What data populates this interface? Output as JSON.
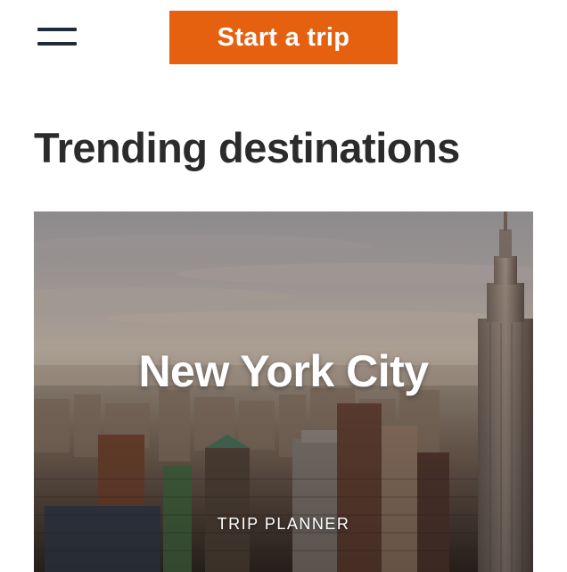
{
  "header": {
    "menu_icon": "hamburger-menu-icon",
    "cta_label": "Start a trip",
    "cta_color": "#e5600f"
  },
  "trending": {
    "title": "Trending destinations",
    "cards": [
      {
        "title": "New York City",
        "tag": "TRIP PLANNER",
        "image": "new-york-skyline-photo"
      }
    ]
  }
}
